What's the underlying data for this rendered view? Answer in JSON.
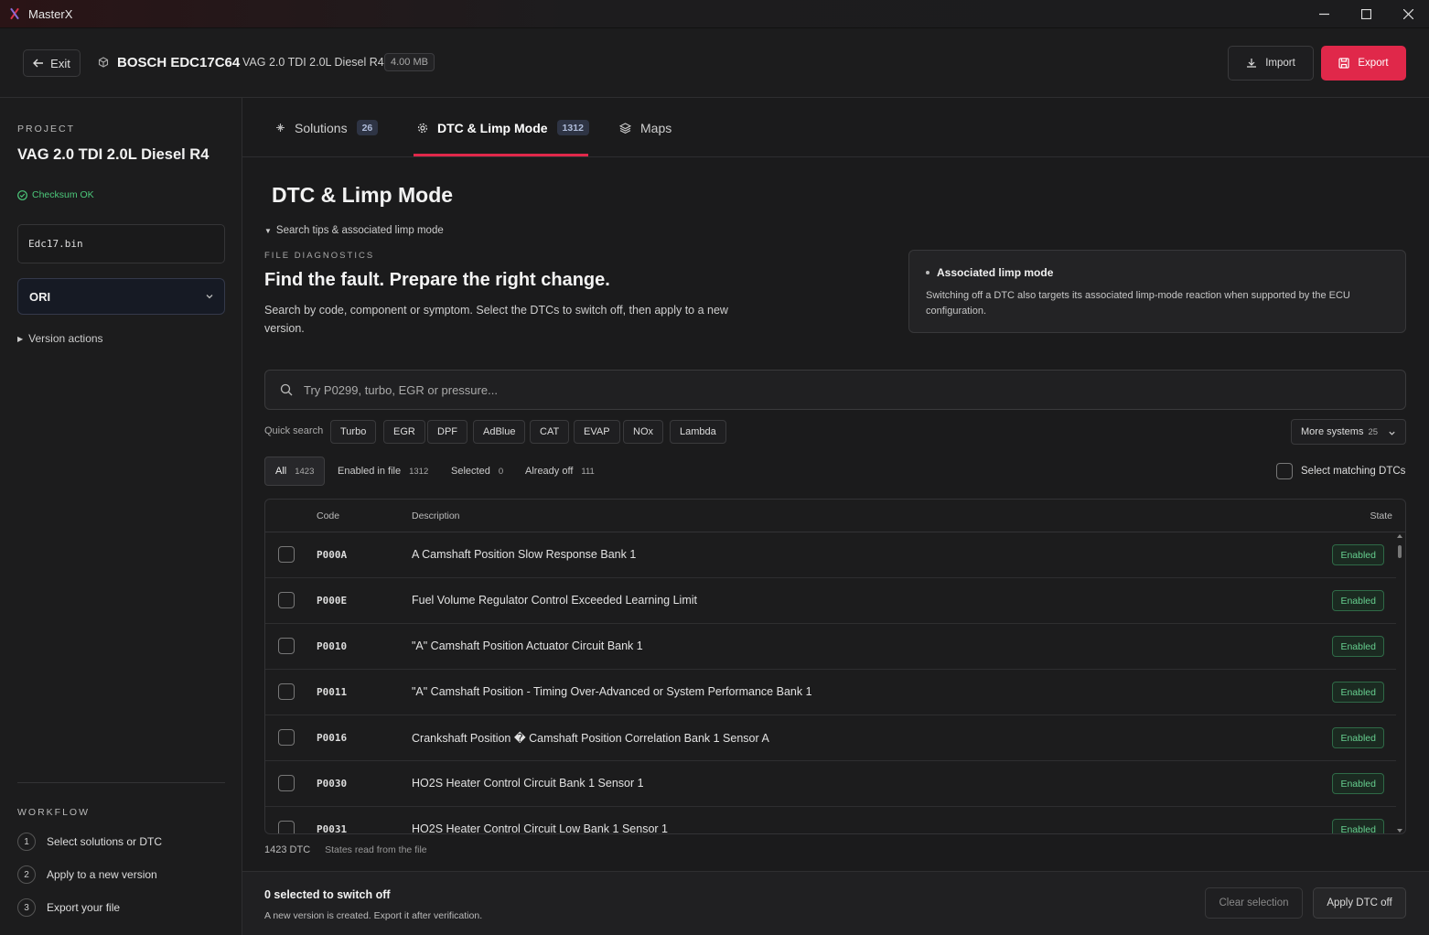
{
  "app": {
    "title": "MasterX"
  },
  "header": {
    "exit_label": "Exit",
    "ecu_name": "BOSCH EDC17C64",
    "ecu_desc": "VAG 2.0 TDI 2.0L Diesel R4",
    "file_size": "4.00 MB",
    "import_label": "Import",
    "export_label": "Export"
  },
  "sidebar": {
    "project_label": "PROJECT",
    "project_name": "VAG 2.0 TDI 2.0L Diesel R4",
    "checksum": "Checksum OK",
    "file_name": "Edc17.bin",
    "version": "ORI",
    "version_actions": "Version actions",
    "workflow_label": "WORKFLOW",
    "workflow": [
      {
        "num": "1",
        "label": "Select solutions or DTC"
      },
      {
        "num": "2",
        "label": "Apply to a new version"
      },
      {
        "num": "3",
        "label": "Export your file"
      }
    ]
  },
  "tabs": [
    {
      "label": "Solutions",
      "count": "26"
    },
    {
      "label": "DTC & Limp Mode",
      "count": "1312"
    },
    {
      "label": "Maps"
    }
  ],
  "page": {
    "title": "DTC & Limp Mode",
    "tips_toggle": "Search tips & associated limp mode",
    "fd_label": "FILE DIAGNOSTICS",
    "fd_headline": "Find the fault. Prepare the right change.",
    "fd_desc": "Search by code, component or symptom. Select the DTCs to switch off, then apply to a new version.",
    "limp_title": "Associated limp mode",
    "limp_text": "Switching off a DTC also targets its associated limp-mode reaction when supported by the ECU configuration."
  },
  "search": {
    "placeholder": "Try P0299, turbo, EGR or pressure..."
  },
  "quick_search": {
    "label": "Quick search",
    "chips": [
      "Turbo",
      "EGR",
      "DPF",
      "AdBlue",
      "CAT",
      "EVAP",
      "NOx",
      "Lambda"
    ],
    "more_label": "More systems",
    "more_count": "25"
  },
  "filters": [
    {
      "label": "All",
      "count": "1423"
    },
    {
      "label": "Enabled in file",
      "count": "1312"
    },
    {
      "label": "Selected",
      "count": "0"
    },
    {
      "label": "Already off",
      "count": "111"
    }
  ],
  "select_matching": "Select matching DTCs",
  "table": {
    "headers": {
      "code": "Code",
      "description": "Description",
      "state": "State"
    },
    "rows": [
      {
        "code": "P000A",
        "description": "A Camshaft Position Slow Response Bank 1",
        "state": "Enabled"
      },
      {
        "code": "P000E",
        "description": "Fuel Volume Regulator Control Exceeded Learning Limit",
        "state": "Enabled"
      },
      {
        "code": "P0010",
        "description": "\"A\" Camshaft Position Actuator Circuit Bank 1",
        "state": "Enabled"
      },
      {
        "code": "P0011",
        "description": "\"A\" Camshaft Position - Timing Over-Advanced or System Performance Bank 1",
        "state": "Enabled"
      },
      {
        "code": "P0016",
        "description": "Crankshaft Position � Camshaft Position Correlation Bank 1 Sensor A",
        "state": "Enabled"
      },
      {
        "code": "P0030",
        "description": "HO2S Heater Control Circuit Bank 1 Sensor 1",
        "state": "Enabled"
      },
      {
        "code": "P0031",
        "description": "HO2S Heater Control Circuit Low Bank 1 Sensor 1",
        "state": "Enabled"
      }
    ]
  },
  "footer": {
    "count": "1423 DTC",
    "states_note": "States read from the file",
    "selected_title": "0 selected to switch off",
    "selected_sub": "A new version is created. Export it after verification.",
    "clear_label": "Clear selection",
    "apply_label": "Apply DTC off"
  },
  "colors": {
    "accent": "#e0284a",
    "enabled": "#66cf8f",
    "checksum": "#4cc77a"
  }
}
